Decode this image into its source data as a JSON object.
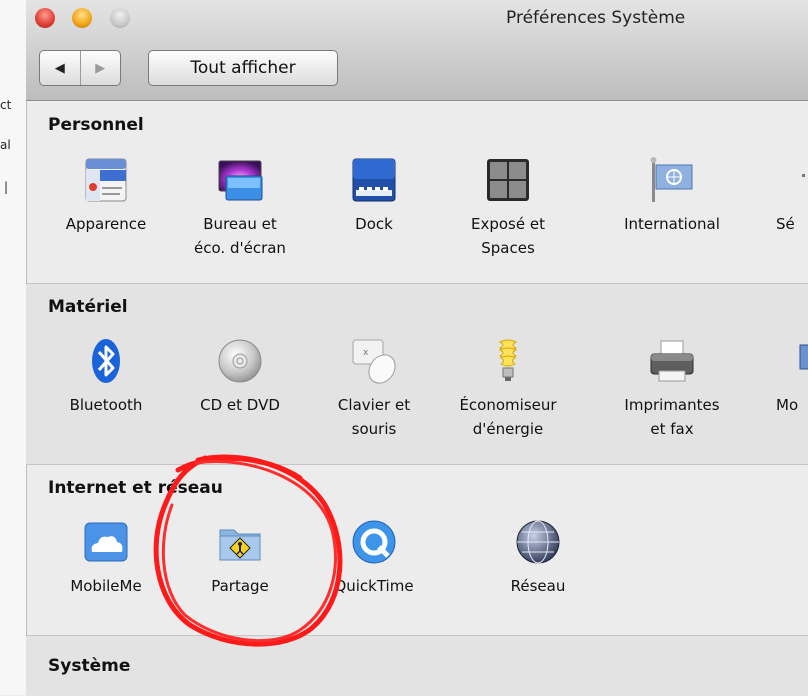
{
  "window": {
    "title": "Préférences Système"
  },
  "toolbar": {
    "back_glyph": "◀",
    "forward_glyph": "▶",
    "show_all_label": "Tout afficher"
  },
  "background_fragments": [
    "ct",
    "al",
    "|"
  ],
  "sections": {
    "personnel": {
      "title": "Personnel",
      "items": [
        {
          "label": "Apparence",
          "icon": "apparence-icon"
        },
        {
          "label": "Bureau et\néco. d'écran",
          "icon": "desktop-screensaver-icon"
        },
        {
          "label": "Dock",
          "icon": "dock-icon"
        },
        {
          "label": "Exposé et\nSpaces",
          "icon": "expose-spaces-icon"
        },
        {
          "label": "International",
          "icon": "international-flag-icon"
        },
        {
          "label": "Sé",
          "icon": "security-icon"
        }
      ]
    },
    "materiel": {
      "title": "Matériel",
      "items": [
        {
          "label": "Bluetooth",
          "icon": "bluetooth-icon"
        },
        {
          "label": "CD et DVD",
          "icon": "cd-dvd-icon"
        },
        {
          "label": "Clavier et\nsouris",
          "icon": "keyboard-mouse-icon"
        },
        {
          "label": "Économiseur\nd'énergie",
          "icon": "energy-saver-bulb-icon"
        },
        {
          "label": "Imprimantes\net fax",
          "icon": "printer-icon"
        },
        {
          "label": "Mo",
          "icon": "monitor-icon"
        }
      ]
    },
    "internet": {
      "title": "Internet et réseau",
      "items": [
        {
          "label": "MobileMe",
          "icon": "mobileme-cloud-icon"
        },
        {
          "label": "Partage",
          "icon": "sharing-folder-icon"
        },
        {
          "label": "QuickTime",
          "icon": "quicktime-icon"
        },
        {
          "label": "Réseau",
          "icon": "network-globe-icon"
        }
      ]
    },
    "systeme": {
      "title": "Système"
    }
  },
  "annotation": {
    "shape": "hand-drawn circle around Partage",
    "color": "#ff1a1a"
  }
}
